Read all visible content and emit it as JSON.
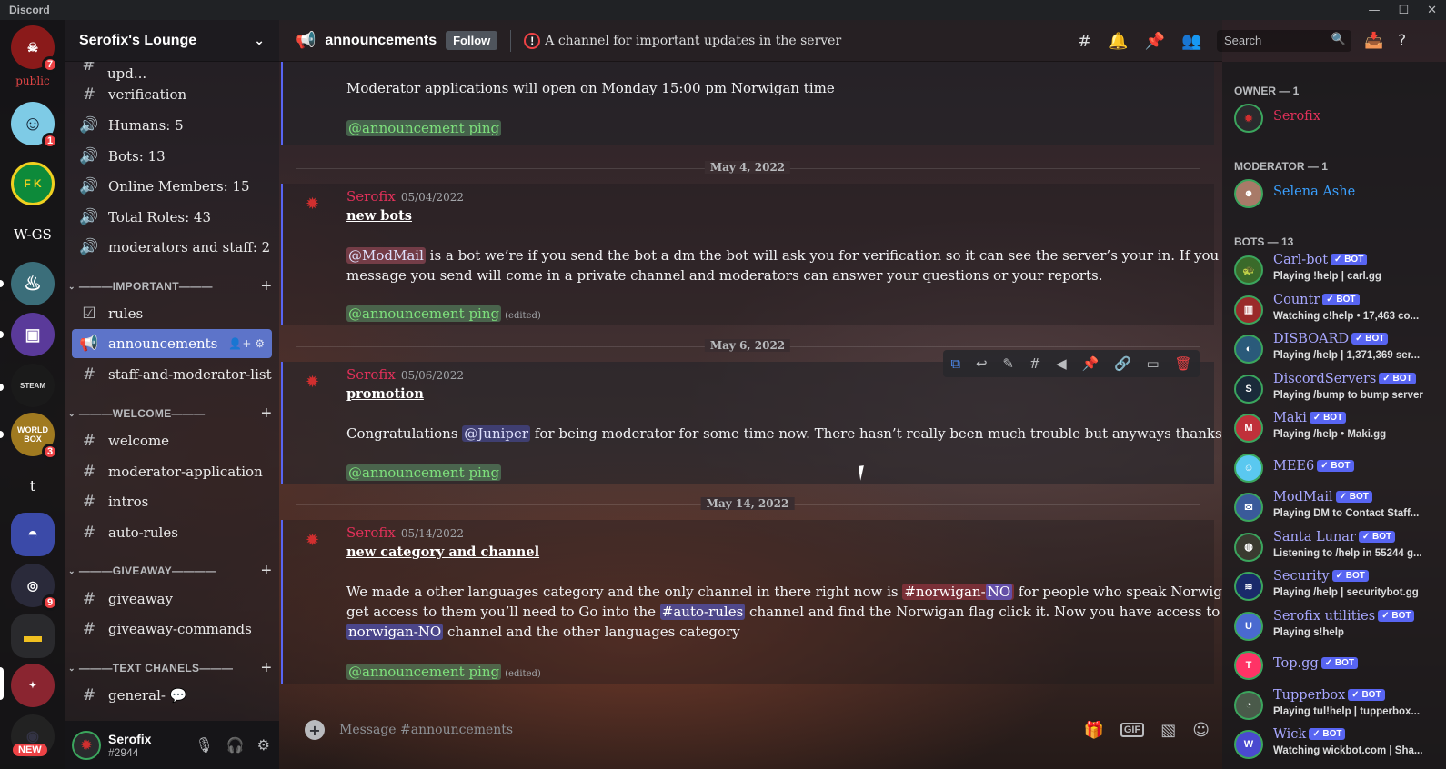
{
  "window": {
    "title": "Discord",
    "controls": {
      "minimize": "—",
      "maximize": "☐",
      "close": "✕"
    }
  },
  "guilds": [
    {
      "name": "Serofix's Lounge",
      "badge": "7",
      "color": "#8a1a1a"
    },
    {
      "name": "public",
      "label": "public"
    },
    {
      "name": "emoji-server",
      "badge": "1",
      "color": "#7ecbe6"
    },
    {
      "name": "FK",
      "label": "F K",
      "color": "#0d8a3a"
    },
    {
      "name": "W-GS",
      "label": "W-GS"
    },
    {
      "name": "bottle",
      "color": "#3b6e7a"
    },
    {
      "name": "gaming",
      "color": "#5a3a9a"
    },
    {
      "name": "steam-unlocked",
      "label": "STEAM",
      "color": "#1a1a1a"
    },
    {
      "name": "world-box",
      "badge": "3",
      "label": "WORLD BOX",
      "color": "#a07a20"
    },
    {
      "name": "t",
      "label": "t"
    },
    {
      "name": "bot-server",
      "color": "#3b4aa8"
    },
    {
      "name": "folder",
      "badge": "9"
    },
    {
      "name": "yellow-folder",
      "color": "#2a2a2d"
    },
    {
      "name": "red-server",
      "color": "#8a2530"
    },
    {
      "name": "new-server",
      "label": "NEW"
    }
  ],
  "server": {
    "name": "Serofix's Lounge"
  },
  "channels": {
    "partial_top": "discord-moderator-upd...",
    "top": [
      {
        "icon": "#",
        "label": "verification"
      },
      {
        "icon": "🔊",
        "label": "Humans: 5"
      },
      {
        "icon": "🔊",
        "label": "Bots: 13"
      },
      {
        "icon": "🔊",
        "label": "Online Members: 15"
      },
      {
        "icon": "🔊",
        "label": "Total Roles: 43"
      },
      {
        "icon": "🔊",
        "label": "moderators and staff: 2"
      }
    ],
    "cat_important": "———IMPORTANT———",
    "important": [
      {
        "icon": "☑",
        "label": "rules"
      },
      {
        "icon": "📢",
        "label": "announcements"
      },
      {
        "icon": "#",
        "label": "staff-and-moderator-list"
      }
    ],
    "cat_welcome": "———WELCOME———",
    "welcome": [
      {
        "icon": "#",
        "label": "welcome"
      },
      {
        "icon": "#",
        "label": "moderator-application"
      },
      {
        "icon": "#",
        "label": "intros"
      },
      {
        "icon": "#",
        "label": "auto-rules"
      }
    ],
    "cat_giveaway": "———GIVEAWAY————",
    "giveaway": [
      {
        "icon": "#",
        "label": "giveaway"
      },
      {
        "icon": "#",
        "label": "giveaway-commands"
      }
    ],
    "cat_text": "———TEXT CHANELS———",
    "text": [
      {
        "icon": "#",
        "label": "general- 💬"
      }
    ]
  },
  "user": {
    "name": "Serofix",
    "tag": "#2944"
  },
  "header": {
    "channel": "announcements",
    "follow": "Follow",
    "topic": "A channel for important updates in the server",
    "search_placeholder": "Search"
  },
  "messages": {
    "m0_line": "Moderator applications will open on Monday 15:00 pm Norwigan time",
    "ping": "@announcement ping",
    "edited": "(edited)",
    "d1": "May 4, 2022",
    "m1": {
      "author": "Serofix",
      "time": "05/04/2022",
      "title": "new bots",
      "mention": "@ModMail",
      "l1": " is a bot we’re if you send the bot a dm the bot will ask you for verification so it can see the server’s your in. If you click verify the",
      "l2": "message you send will come in a private channel and moderators can answer your questions or your reports."
    },
    "d2": "May 6, 2022",
    "m2": {
      "author": "Serofix",
      "time": "05/06/2022",
      "title": " promotion",
      "pre": "Congratulations ",
      "mention": "@Juniper",
      "post": " for being moderator for some time now. There hasn’t really been much trouble but anyways thanks."
    },
    "d3": "May 14, 2022",
    "m3": {
      "author": "Serofix",
      "time": "05/14/2022",
      "title": "new category and channel",
      "l1a": "We made a other languages category and the only channel in there right now is ",
      "c1": "#norwigan-",
      "c1tag": "NO",
      "l1b": " for people who speak Norwigan to talk in. To",
      "l2a": "get access to them you’ll need to Go into the ",
      "c2": "#auto-rules",
      "l2b": " channel and find the Norwigan flag click it. Now you have access to the ",
      "c3": "#",
      "l3a": "norwigan-",
      "l3tag": "NO",
      "l3b": " channel and the other languages category"
    }
  },
  "composer": {
    "placeholder": "Message #announcements",
    "gif": "GIF"
  },
  "members": {
    "owner_label": "OWNER — 1",
    "owner": {
      "name": "Serofix",
      "color": "#e2315a"
    },
    "mod_label": "MODERATOR — 1",
    "mod": {
      "name": "Selena Ashe",
      "color": "#3aa0ff"
    },
    "bots_label": "BOTS — 13",
    "bot_tag": "✓ BOT",
    "bots": [
      {
        "name": "Carl-bot",
        "activity": "Playing !help | carl.gg",
        "color": "#3a6a2a"
      },
      {
        "name": "Countr",
        "activity": "Watching c!help • 17,463 co...",
        "color": "#9a2a2a"
      },
      {
        "name": "DISBOARD",
        "activity": "Playing /help | 1,371,369 ser...",
        "color": "#2a5a7a"
      },
      {
        "name": "DiscordServers",
        "activity": "Playing /bump to bump server",
        "color": "#1a2a3a"
      },
      {
        "name": "Maki",
        "activity": "Playing /help • Maki.gg",
        "color": "#c0303a"
      },
      {
        "name": "MEE6",
        "activity": "",
        "color": "#5ac8f0"
      },
      {
        "name": "ModMail",
        "activity": "Playing DM to Contact Staff...",
        "color": "#3a5a9a"
      },
      {
        "name": "Santa Lunar",
        "activity": "Listening to /help in 55244 g...",
        "color": "#3a3a30"
      },
      {
        "name": "Security",
        "activity": "Playing /help | securitybot.gg",
        "color": "#1a2a6a"
      },
      {
        "name": "Serofix utilities",
        "activity": "Playing s!help",
        "color": "#4a6ad0"
      },
      {
        "name": "Top.gg",
        "activity": "",
        "color": "#ff3366"
      },
      {
        "name": "Tupperbox",
        "activity": "Playing tul!help | tupperbox...",
        "color": "#4a5a4a"
      },
      {
        "name": "Wick",
        "activity": "Watching wickbot.com | Sha...",
        "color": "#4a4ad0"
      }
    ]
  }
}
